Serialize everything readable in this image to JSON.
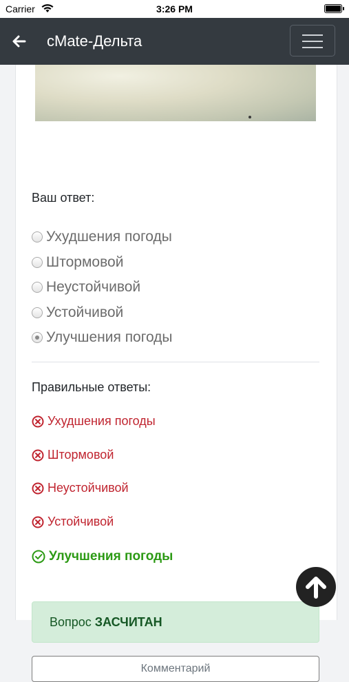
{
  "status_bar": {
    "carrier": "Carrier",
    "time": "3:26 PM"
  },
  "navbar": {
    "back_icon": "arrow-left-icon",
    "title": "cMate-Дельта",
    "menu_icon": "hamburger-icon"
  },
  "question": {
    "your_answer_label": "Ваш ответ:",
    "options": [
      {
        "label": "Ухудшения погоды",
        "selected": false
      },
      {
        "label": "Штормовой",
        "selected": false
      },
      {
        "label": "Неустойчивой",
        "selected": false
      },
      {
        "label": "Устойчивой",
        "selected": false
      },
      {
        "label": "Улучшения погоды",
        "selected": true
      }
    ]
  },
  "correct_answers": {
    "label": "Правильные ответы:",
    "items": [
      {
        "text": "Ухудшения погоды",
        "correct": false,
        "icon": "x-circle-icon"
      },
      {
        "text": "Штормовой",
        "correct": false,
        "icon": "x-circle-icon"
      },
      {
        "text": "Неустойчивой",
        "correct": false,
        "icon": "x-circle-icon"
      },
      {
        "text": "Устойчивой",
        "correct": false,
        "icon": "x-circle-icon"
      },
      {
        "text": "Улучшения погоды",
        "correct": true,
        "icon": "check-circle-icon"
      }
    ]
  },
  "result": {
    "prefix": "Вопрос",
    "status": "ЗАСЧИТАН"
  },
  "comment_button": "Комментарий",
  "scroll_top_icon": "arrow-up-icon",
  "colors": {
    "navbar": "#343a40",
    "wrong": "#c0242f",
    "correct": "#2c9a14",
    "alert_bg": "#d4edda"
  }
}
